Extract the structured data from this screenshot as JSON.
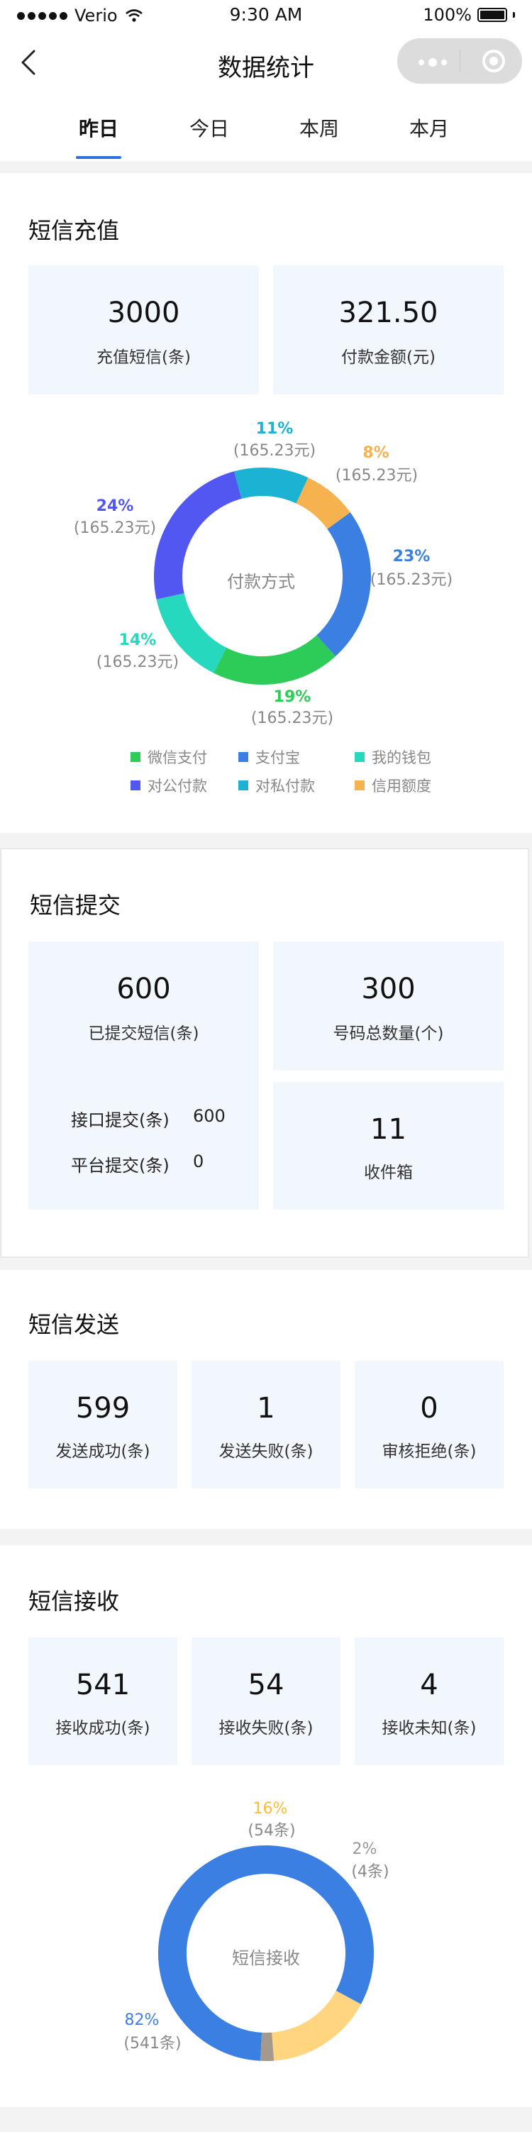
{
  "status_bar": {
    "carrier": "Verio",
    "time": "9:30 AM",
    "battery": "100%"
  },
  "nav": {
    "title": "数据统计"
  },
  "tabs": [
    "昨日",
    "今日",
    "本周",
    "本月"
  ],
  "active_tab": 0,
  "recharge": {
    "title": "短信充值",
    "cards": [
      {
        "value": "3000",
        "label": "充值短信(条)"
      },
      {
        "value": "321.50",
        "label": "付款金额(元)"
      }
    ],
    "chart_center": "付款方式"
  },
  "submit": {
    "title": "短信提交",
    "submitted": {
      "value": "600",
      "label": "已提交短信(条)"
    },
    "rows": [
      {
        "label": "接口提交(条)",
        "value": "600"
      },
      {
        "label": "平台提交(条)",
        "value": "0"
      }
    ],
    "numbers": {
      "value": "300",
      "label": "号码总数量(个)"
    },
    "inbox": {
      "value": "11",
      "label": "收件箱"
    }
  },
  "send": {
    "title": "短信发送",
    "cards": [
      {
        "value": "599",
        "label": "发送成功(条)"
      },
      {
        "value": "1",
        "label": "发送失败(条)"
      },
      {
        "value": "0",
        "label": "审核拒绝(条)"
      }
    ]
  },
  "receive": {
    "title": "短信接收",
    "cards": [
      {
        "value": "541",
        "label": "接收成功(条)"
      },
      {
        "value": "54",
        "label": "接收失败(条)"
      },
      {
        "value": "4",
        "label": "接收未知(条)"
      }
    ],
    "chart_center": "短信接收"
  },
  "chart_data": [
    {
      "type": "pie",
      "categories": [
        "支付宝",
        "微信支付",
        "我的钱包",
        "对公付款",
        "对私付款",
        "信用额度"
      ],
      "values": [
        23,
        19,
        14,
        24,
        11,
        8
      ],
      "value_labels": [
        "23%",
        "19%",
        "14%",
        "24%",
        "11%",
        "8%"
      ],
      "amount_labels": [
        "(165.23元)",
        "(165.23元)",
        "(165.23元)",
        "(165.23元)",
        "(165.23元)",
        "(165.23元)"
      ],
      "colors": [
        "#3c7fe3",
        "#2dcb57",
        "#26d8bd",
        "#5157f0",
        "#1cb2d3",
        "#f6b24f"
      ],
      "legend": [
        {
          "name": "微信支付",
          "color": "#2dcb57"
        },
        {
          "name": "支付宝",
          "color": "#3c7fe3"
        },
        {
          "name": "我的钱包",
          "color": "#26d8bd"
        },
        {
          "name": "对公付款",
          "color": "#5157f0"
        },
        {
          "name": "对私付款",
          "color": "#1cb2d3"
        },
        {
          "name": "信用额度",
          "color": "#f6b24f"
        }
      ],
      "center_label": "付款方式",
      "donut": true
    },
    {
      "type": "pie",
      "categories": [
        "接收成功",
        "接收失败",
        "接收未知"
      ],
      "values": [
        82,
        16,
        2
      ],
      "value_labels": [
        "82%",
        "16%",
        "2%"
      ],
      "amount_labels": [
        "(541条)",
        "(54条)",
        "(4条)"
      ],
      "colors": [
        "#3c7fe3",
        "#ffd57f",
        "#a3998c"
      ],
      "label_colors": [
        "#3c7fe3",
        "#f7be3a",
        "#999999"
      ],
      "center_label": "短信接收",
      "donut": true
    }
  ],
  "colors": {
    "accent": "#2f6fde",
    "card_bg": "#f2f7fe"
  }
}
